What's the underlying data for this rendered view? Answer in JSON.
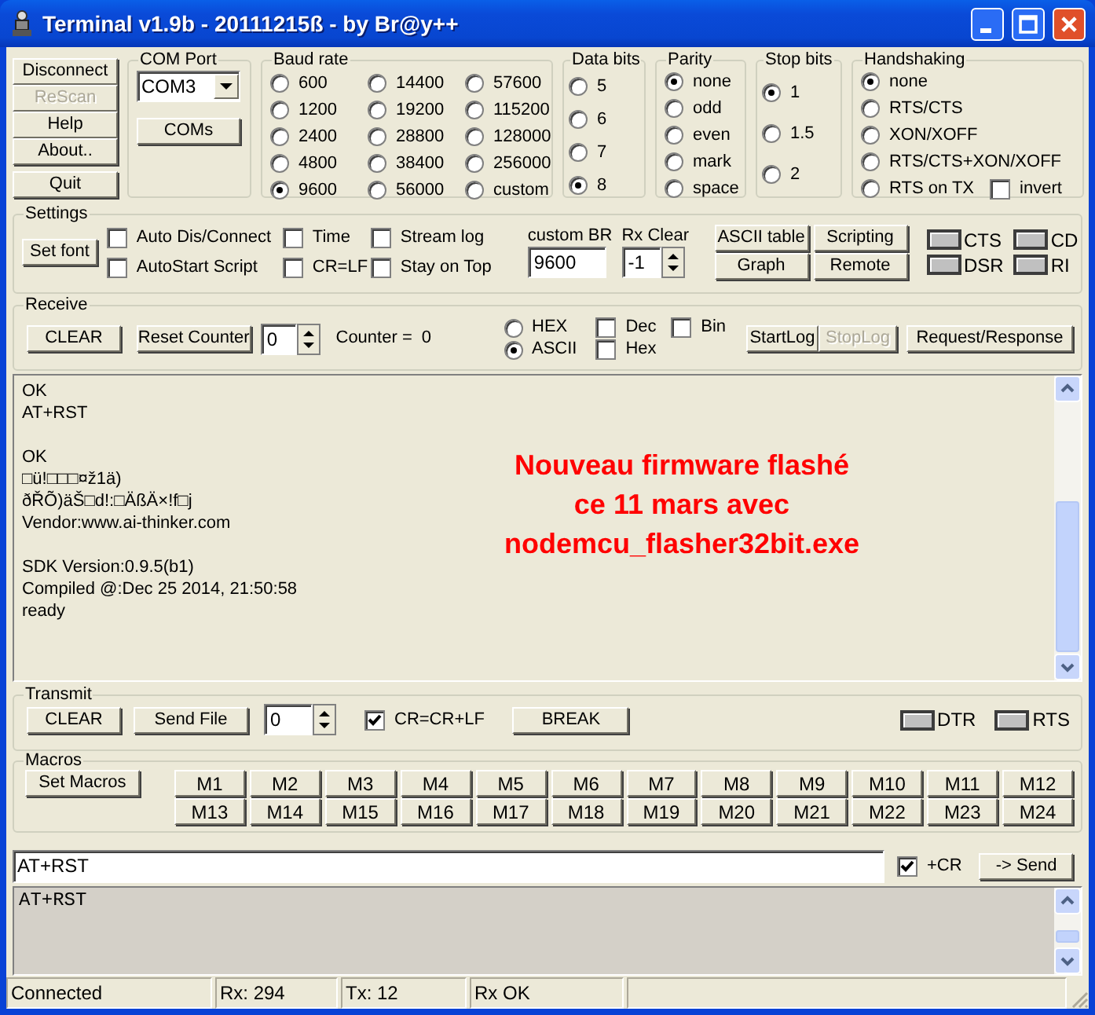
{
  "window": {
    "title": "Terminal v1.9b - 20111215ß - by Br@y++"
  },
  "top_buttons": [
    {
      "label": "Disconnect",
      "disabled": false
    },
    {
      "label": "ReScan",
      "disabled": true
    },
    {
      "label": "Help",
      "disabled": false
    },
    {
      "label": "About..",
      "disabled": false
    },
    {
      "label": "Quit",
      "disabled": false
    }
  ],
  "com_port": {
    "title": "COM Port",
    "value": "COM3",
    "button": "COMs"
  },
  "baud_rate": {
    "title": "Baud rate",
    "options": [
      {
        "label": "600",
        "selected": false
      },
      {
        "label": "1200",
        "selected": false
      },
      {
        "label": "2400",
        "selected": false
      },
      {
        "label": "4800",
        "selected": false
      },
      {
        "label": "9600",
        "selected": true
      },
      {
        "label": "14400",
        "selected": false
      },
      {
        "label": "19200",
        "selected": false
      },
      {
        "label": "28800",
        "selected": false
      },
      {
        "label": "38400",
        "selected": false
      },
      {
        "label": "56000",
        "selected": false
      },
      {
        "label": "57600",
        "selected": false
      },
      {
        "label": "115200",
        "selected": false
      },
      {
        "label": "128000",
        "selected": false
      },
      {
        "label": "256000",
        "selected": false
      },
      {
        "label": "custom",
        "selected": false
      }
    ]
  },
  "data_bits": {
    "title": "Data bits",
    "options": [
      {
        "label": "5",
        "selected": false
      },
      {
        "label": "6",
        "selected": false
      },
      {
        "label": "7",
        "selected": false
      },
      {
        "label": "8",
        "selected": true
      }
    ]
  },
  "parity": {
    "title": "Parity",
    "options": [
      {
        "label": "none",
        "selected": true
      },
      {
        "label": "odd",
        "selected": false
      },
      {
        "label": "even",
        "selected": false
      },
      {
        "label": "mark",
        "selected": false
      },
      {
        "label": "space",
        "selected": false
      }
    ]
  },
  "stop_bits": {
    "title": "Stop bits",
    "options": [
      {
        "label": "1",
        "selected": true
      },
      {
        "label": "1.5",
        "selected": false
      },
      {
        "label": "2",
        "selected": false
      }
    ]
  },
  "handshaking": {
    "title": "Handshaking",
    "options": [
      {
        "label": "none",
        "selected": true
      },
      {
        "label": "RTS/CTS",
        "selected": false
      },
      {
        "label": "XON/XOFF",
        "selected": false
      },
      {
        "label": "RTS/CTS+XON/XOFF",
        "selected": false
      },
      {
        "label": "RTS on TX",
        "selected": false
      }
    ],
    "invert": {
      "label": "invert",
      "checked": false
    }
  },
  "settings": {
    "title": "Settings",
    "set_font": "Set font",
    "checkboxes": [
      {
        "label": "Auto Dis/Connect",
        "checked": false
      },
      {
        "label": "AutoStart Script",
        "checked": false
      },
      {
        "label": "Time",
        "checked": false
      },
      {
        "label": "CR=LF",
        "checked": false
      },
      {
        "label": "Stream log",
        "checked": false
      },
      {
        "label": "Stay on Top",
        "checked": false
      }
    ],
    "custom_br": {
      "label": "custom BR",
      "value": "9600"
    },
    "rx_clear": {
      "label": "Rx Clear",
      "value": "-1"
    },
    "buttons": [
      "ASCII table",
      "Graph",
      "Scripting",
      "Remote"
    ],
    "leds": [
      "CTS",
      "DSR",
      "CD",
      "RI"
    ]
  },
  "receive": {
    "title": "Receive",
    "clear": "CLEAR",
    "reset_counter": "Reset Counter",
    "counter_step": "0",
    "counter_label": "Counter =",
    "counter_value": "0",
    "modes": [
      {
        "label": "HEX",
        "selected": false
      },
      {
        "label": "ASCII",
        "selected": true
      }
    ],
    "checkboxes": [
      {
        "label": "Dec",
        "checked": false
      },
      {
        "label": "Hex",
        "checked": false
      },
      {
        "label": "Bin",
        "checked": false
      }
    ],
    "buttons": [
      {
        "label": "StartLog",
        "disabled": false
      },
      {
        "label": "StopLog",
        "disabled": true
      },
      {
        "label": "Request/Response",
        "disabled": false
      }
    ]
  },
  "receive_log": {
    "blocks": [
      [
        "OK",
        "AT+RST"
      ],
      [
        "OK",
        "□ü!□□□¤ž1ä)",
        "ðŘÕ)äŠ□d!:□ÄßÄ×!f□j",
        "Vendor:www.ai-thinker.com"
      ],
      [
        "SDK Version:0.9.5(b1)",
        "Compiled @:Dec 25 2014, 21:50:58",
        "ready"
      ]
    ],
    "note": [
      "Nouveau firmware flashé",
      "ce 11 mars avec",
      "nodemcu_flasher32bit.exe"
    ]
  },
  "transmit": {
    "title": "Transmit",
    "clear": "CLEAR",
    "send_file": "Send File",
    "spin_value": "0",
    "cr_lf": {
      "label": "CR=CR+LF",
      "checked": true
    },
    "break": "BREAK",
    "leds": [
      "DTR",
      "RTS"
    ]
  },
  "macros": {
    "title": "Macros",
    "set_macros": "Set Macros",
    "buttons": [
      "M1",
      "M2",
      "M3",
      "M4",
      "M5",
      "M6",
      "M7",
      "M8",
      "M9",
      "M10",
      "M11",
      "M12",
      "M13",
      "M14",
      "M15",
      "M16",
      "M17",
      "M18",
      "M19",
      "M20",
      "M21",
      "M22",
      "M23",
      "M24"
    ]
  },
  "send": {
    "value": "AT+RST",
    "plus_cr": {
      "label": "+CR",
      "checked": true
    },
    "button": "-> Send"
  },
  "transmit_log": {
    "lines": [
      "AT+RST"
    ]
  },
  "status_bar": [
    "Connected",
    "Rx: 294",
    "Tx: 12",
    "Rx OK"
  ]
}
